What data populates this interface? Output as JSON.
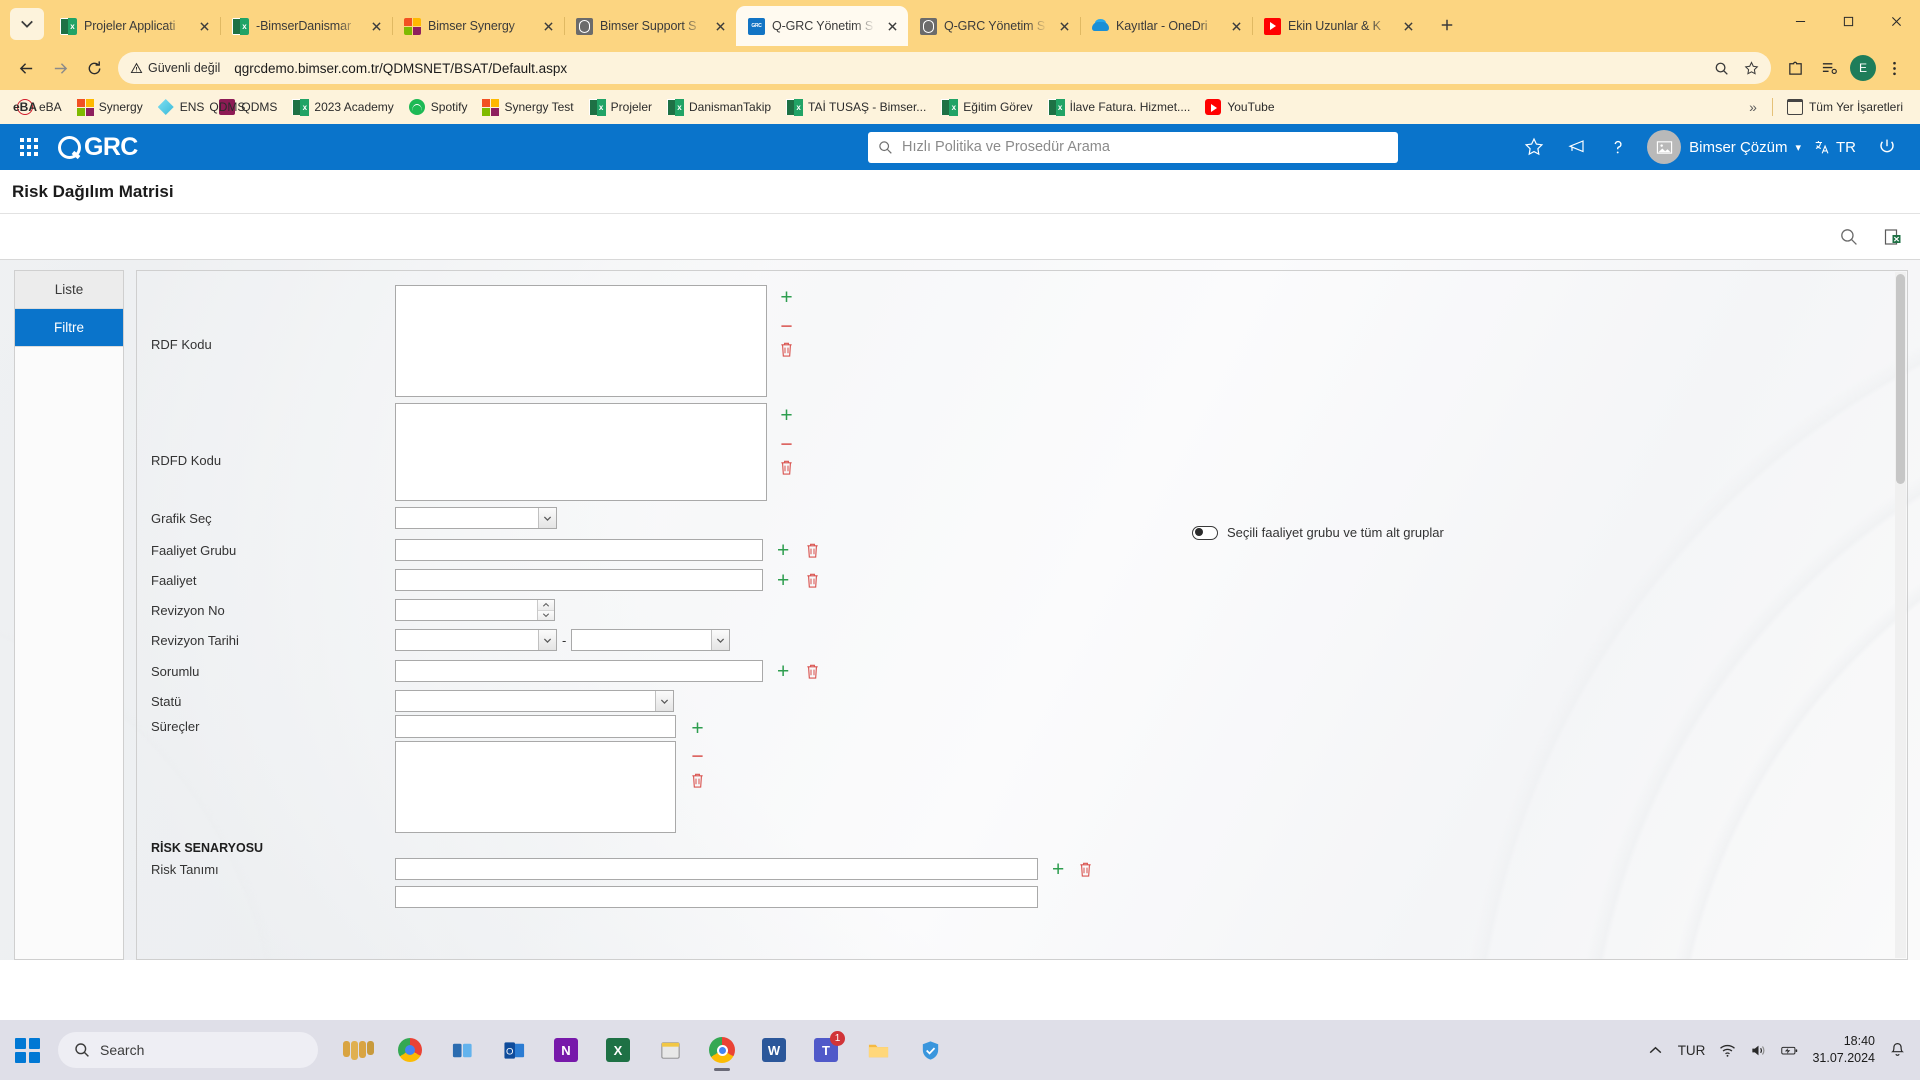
{
  "browser": {
    "tabs": [
      {
        "title": "Projeler Applicati",
        "icon": "excel-icon",
        "active": false
      },
      {
        "title": "-BimserDanismar",
        "icon": "excel-icon",
        "active": false
      },
      {
        "title": "Bimser Synergy",
        "icon": "microsoft-icon",
        "active": false
      },
      {
        "title": "Bimser Support S",
        "icon": "globe-icon",
        "active": false
      },
      {
        "title": "Q-GRC Yönetim S",
        "icon": "qgrc-icon",
        "active": true
      },
      {
        "title": "Q-GRC Yönetim S",
        "icon": "globe-icon",
        "active": false
      },
      {
        "title": "Kayıtlar - OneDri",
        "icon": "onedrive-icon",
        "active": false
      },
      {
        "title": "Ekin Uzunlar & K",
        "icon": "youtube-icon",
        "active": false
      }
    ],
    "new_tab_label": "+",
    "address": {
      "security_label": "Güvenli değil",
      "url": "qgrcdemo.bimser.com.tr/QDMSNET/BSAT/Default.aspx"
    },
    "profile_initial": "E",
    "bookmarks": [
      {
        "label": "eBA",
        "icon": "eba-icon"
      },
      {
        "label": "Synergy",
        "icon": "microsoft-icon"
      },
      {
        "label": "ENS",
        "icon": "ens-icon"
      },
      {
        "label": "QDMS",
        "icon": "qdms-icon"
      },
      {
        "label": "2023 Academy",
        "icon": "excel-icon"
      },
      {
        "label": "Spotify",
        "icon": "spotify-icon"
      },
      {
        "label": "Synergy Test",
        "icon": "microsoft-icon"
      },
      {
        "label": "Projeler",
        "icon": "excel-icon"
      },
      {
        "label": "DanismanTakip",
        "icon": "excel-icon"
      },
      {
        "label": "TAİ TUSAŞ - Bimser...",
        "icon": "excel-icon"
      },
      {
        "label": "Eğitim Görev",
        "icon": "excel-icon"
      },
      {
        "label": "İlave Fatura. Hizmet....",
        "icon": "excel-icon"
      },
      {
        "label": "YouTube",
        "icon": "youtube-icon"
      }
    ],
    "bookmarks_overflow": "»",
    "all_bookmarks_label": "Tüm Yer İşaretleri"
  },
  "app": {
    "brand": "GRC",
    "search_placeholder": "Hızlı Politika ve Prosedür Arama",
    "user_name": "Bimser Çözüm",
    "language": "TR",
    "page_title": "Risk Dağılım Matrisi",
    "left_tabs": [
      {
        "label": "Liste",
        "active": false
      },
      {
        "label": "Filtre",
        "active": true
      }
    ],
    "toggle": {
      "label": "Seçili faaliyet grubu ve tüm alt gruplar",
      "on": false
    },
    "section_header": "RİSK SENARYOSU",
    "fields": [
      {
        "label": "RDF Kodu",
        "value": "",
        "type": "textarea"
      },
      {
        "label": "RDFD Kodu",
        "value": "",
        "type": "textarea"
      },
      {
        "label": "Grafik Seç",
        "value": "",
        "type": "select"
      },
      {
        "label": "Faaliyet Grubu",
        "value": "",
        "type": "input"
      },
      {
        "label": "Faaliyet",
        "value": "",
        "type": "input"
      },
      {
        "label": "Revizyon No",
        "value": "",
        "type": "spinner"
      },
      {
        "label": "Revizyon Tarihi",
        "value": "",
        "value2": "",
        "separator": "-",
        "type": "daterange"
      },
      {
        "label": "Sorumlu",
        "value": "",
        "type": "input"
      },
      {
        "label": "Statü",
        "value": "",
        "type": "select"
      },
      {
        "label": "Süreçler",
        "value": "",
        "type": "input-textarea"
      },
      {
        "label": "Risk Tanımı",
        "value": "",
        "type": "input"
      }
    ]
  },
  "taskbar": {
    "search_placeholder": "Search",
    "apps": [
      {
        "name": "nail-art-icon",
        "running": false
      },
      {
        "name": "chrome-old-icon",
        "running": false
      },
      {
        "name": "task-view-icon",
        "running": false
      },
      {
        "name": "outlook-icon",
        "running": false
      },
      {
        "name": "onenote-icon",
        "running": false
      },
      {
        "name": "excel-icon",
        "running": false
      },
      {
        "name": "sticky-notes-icon",
        "running": false
      },
      {
        "name": "chrome-icon",
        "running": true
      },
      {
        "name": "word-icon",
        "running": false
      },
      {
        "name": "teams-icon",
        "running": false,
        "badge": "1"
      },
      {
        "name": "file-explorer-icon",
        "running": false
      },
      {
        "name": "security-icon",
        "running": false
      }
    ],
    "language": "TUR",
    "time": "18:40",
    "date": "31.07.2024"
  }
}
